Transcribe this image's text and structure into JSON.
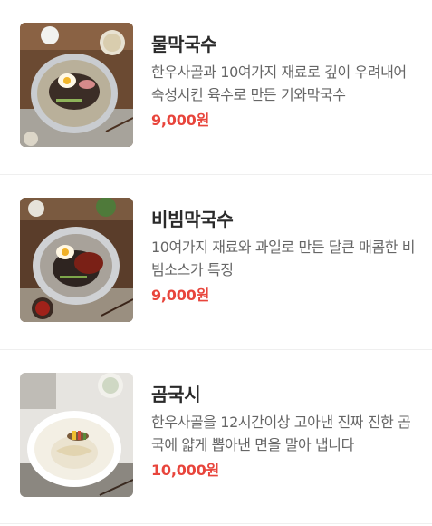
{
  "menu": {
    "items": [
      {
        "name": "물막국수",
        "description": "한우사골과 10여가지 재료로 깊이 우려내어 숙성시킨 육수로 만든 기와막국수",
        "price": "9,000원",
        "image_icon": "cold-buckwheat-noodles-photo"
      },
      {
        "name": "비빔막국수",
        "description": "10여가지 재료와 과일로 만든 달큰 매콤한 비빔소스가 특징",
        "price": "9,000원",
        "image_icon": "spicy-buckwheat-noodles-photo"
      },
      {
        "name": "곰국시",
        "description": "한우사골을 12시간이상 고아낸 진짜 진한 곰국에 얇게 뽑아낸 면을 말아 냅니다",
        "price": "10,000원",
        "image_icon": "beef-bone-noodle-soup-photo"
      }
    ]
  },
  "colors": {
    "price": "#e8453c",
    "name": "#2a2a2a",
    "description": "#666666",
    "divider": "#efefef"
  }
}
